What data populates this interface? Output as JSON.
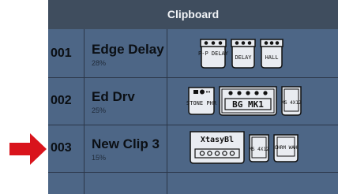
{
  "clipboard": {
    "title": "Clipboard",
    "rows": [
      {
        "number": "001",
        "name": "Edge Delay",
        "percent": "28%",
        "pedals": [
          {
            "label": "P-P DELAY"
          },
          {
            "label": "DELAY"
          },
          {
            "label": "HALL"
          }
        ]
      },
      {
        "number": "002",
        "name": "Ed Drv",
        "percent": "25%",
        "pedals": [
          {
            "label": "STONE PHR"
          },
          {
            "label": "BG MK1"
          },
          {
            "label": "MS 4X12"
          }
        ]
      },
      {
        "number": "003",
        "name": "New Clip 3",
        "percent": "15%",
        "pedals": [
          {
            "label": "XtasyBl"
          },
          {
            "label": "MS 4X12"
          },
          {
            "label": "CHRM WAH"
          }
        ]
      }
    ]
  },
  "selection_indicator": {
    "icon": "arrow-right-icon",
    "color": "#d9141c"
  },
  "colors": {
    "panel": "#4d6686",
    "header": "#3f4d5e",
    "grid": "#2b3648",
    "pedal_fill": "#e9ecf1",
    "pedal_stroke": "#111111"
  }
}
